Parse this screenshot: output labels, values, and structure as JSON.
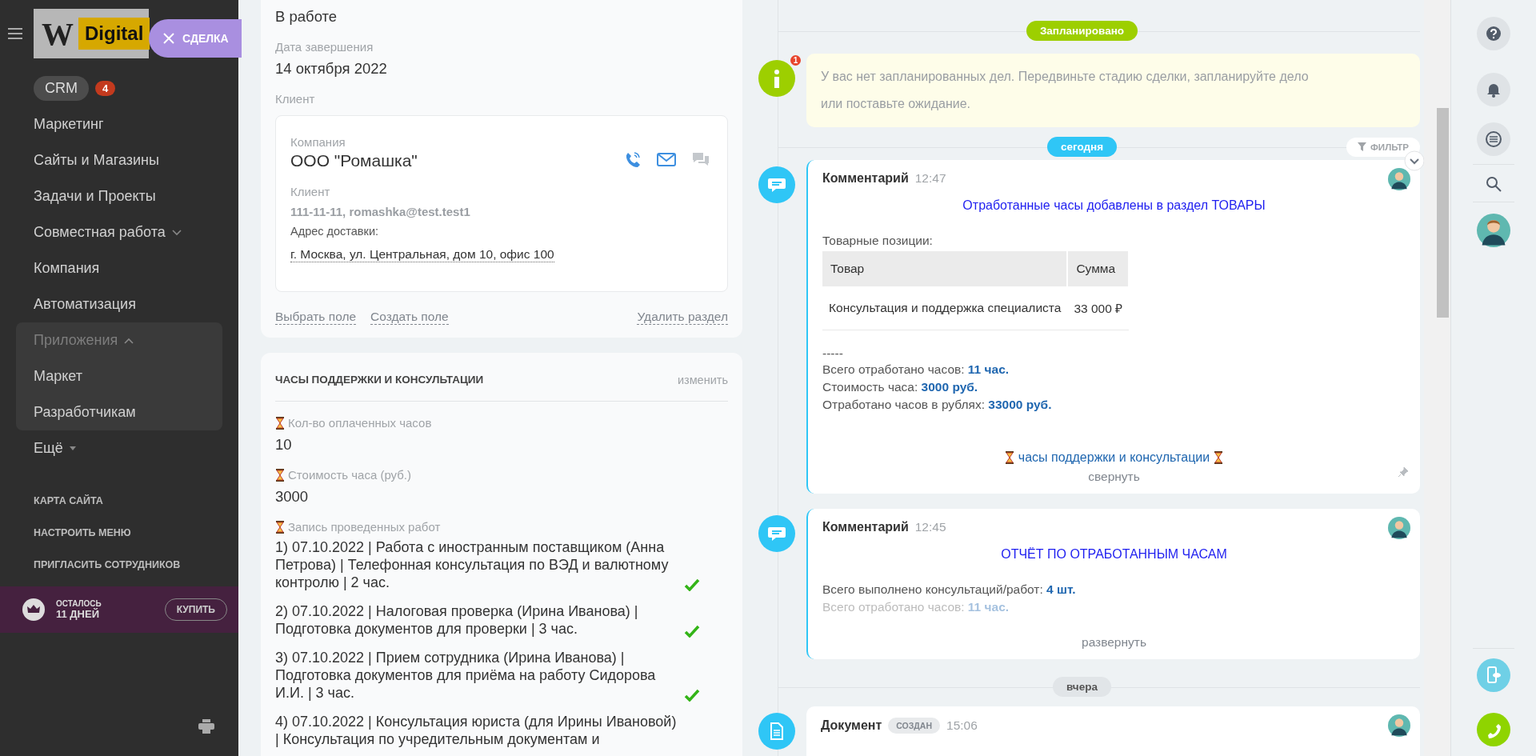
{
  "sidebar": {
    "logo": {
      "mark": "W",
      "text": "Digital"
    },
    "deal_button": "СДЕЛКА",
    "items": [
      {
        "label": "CRM",
        "kind": "pill",
        "badge": "4"
      },
      {
        "label": "Маркетинг",
        "kind": "link"
      },
      {
        "label": "Сайты и Магазины",
        "kind": "link"
      },
      {
        "label": "Задачи и Проекты",
        "kind": "link"
      },
      {
        "label": "Совместная работа",
        "kind": "group",
        "expanded": false
      },
      {
        "label": "Компания",
        "kind": "link"
      },
      {
        "label": "Автоматизация",
        "kind": "link"
      },
      {
        "label": "Приложения",
        "kind": "group",
        "expanded": true,
        "children": [
          {
            "label": "Маркет",
            "kind": "link"
          },
          {
            "label": "Разработчикам",
            "kind": "link"
          }
        ]
      },
      {
        "label": "Ещё",
        "kind": "more"
      }
    ],
    "footer_links": [
      "КАРТА САЙТА",
      "НАСТРОИТЬ МЕНЮ",
      "ПРИГЛАСИТЬ СОТРУДНИКОВ"
    ],
    "trial": {
      "label": "ОСТАЛОСЬ",
      "days": "11 ДНЕЙ",
      "button": "КУПИТЬ"
    }
  },
  "deal_card": {
    "fields": [
      {
        "value": "В работе"
      },
      {
        "label": "Дата завершения",
        "value": "14 октября 2022"
      }
    ],
    "client": {
      "label": "Клиент",
      "company_label": "Компания",
      "company": "ООО \"Ромашка\"",
      "contact_label": "Клиент",
      "contact": "111-11-11, romashka@test.test1",
      "address_label": "Адрес доставки:",
      "address": "г. Москва, ул. Центральная, дом 10, офис 100"
    },
    "actions": [
      "Выбрать поле",
      "Создать поле"
    ],
    "delete_action": "Удалить раздел"
  },
  "hours_card": {
    "title": "ЧАСЫ ПОДДЕРЖКИ И КОНСУЛЬТАЦИИ",
    "edit": "изменить",
    "fields": [
      {
        "label": "Кол-во оплаченных часов",
        "value": "10"
      },
      {
        "label": "Стоимость часа (руб.)",
        "value": "3000"
      }
    ],
    "records_label": "Запись проведенных работ",
    "records": [
      {
        "text": "1) 07.10.2022 | Работа с иностранным поставщиком (Анна Петрова) | Телефонная консультация по ВЭД и валютному контролю | 2 час.",
        "done": true
      },
      {
        "text": "2) 07.10.2022 | Налоговая проверка (Ирина Иванова) | Подготовка документов для проверки | 3 час.",
        "done": true
      },
      {
        "text": "3) 07.10.2022 | Прием сотрудника (Ирина Иванова) | Подготовка документов для приёма на работу Сидорова И.И. | 3 час.",
        "done": true
      },
      {
        "text": "4) 07.10.2022 | Консультация юриста (для Ирины Ивановой) | Консультация по учредительным документам и",
        "done": false
      }
    ]
  },
  "timeline": {
    "planned_pill": "Запланировано",
    "info": {
      "badge": "1",
      "text": "У вас нет запланированных дел. Передвиньте стадию сделки, запланируйте дело или поставьте ожидание."
    },
    "today_pill": "сегодня",
    "filter": "ФИЛЬТР",
    "entries": [
      {
        "kind": "comment",
        "title": "Комментарий",
        "time": "12:47",
        "expanded": true,
        "heading": "Отработанные часы добавлены в раздел ТОВАРЫ",
        "items_label": "Товарные позиции:",
        "table": {
          "columns": [
            "Товар",
            "Сумма"
          ],
          "rows": [
            [
              "Консультация и поддержка специалиста",
              "33 000 ₽"
            ]
          ]
        },
        "separator": "-----",
        "stats": [
          {
            "label": "Всего отработано часов:",
            "value": "11 час."
          },
          {
            "label": "Стоимость часа:",
            "value": "3000 руб."
          },
          {
            "label": "Отработано часов в рублях:",
            "value": "33000 руб."
          }
        ],
        "footer": "часы поддержки и консультации",
        "toggle": "свернуть"
      },
      {
        "kind": "comment",
        "title": "Комментарий",
        "time": "12:45",
        "expanded": false,
        "heading": "ОТЧЁТ ПО ОТРАБОТАННЫМ ЧАСАМ",
        "stats": [
          {
            "label": "Всего выполнено консультаций/работ:",
            "value": "4 шт."
          },
          {
            "label": "Всего отработано часов:",
            "value": "11 час."
          }
        ],
        "toggle": "развернуть"
      }
    ],
    "yesterday_pill": "вчера",
    "document": {
      "title": "Документ",
      "status": "СОЗДАН",
      "time": "15:06"
    }
  }
}
